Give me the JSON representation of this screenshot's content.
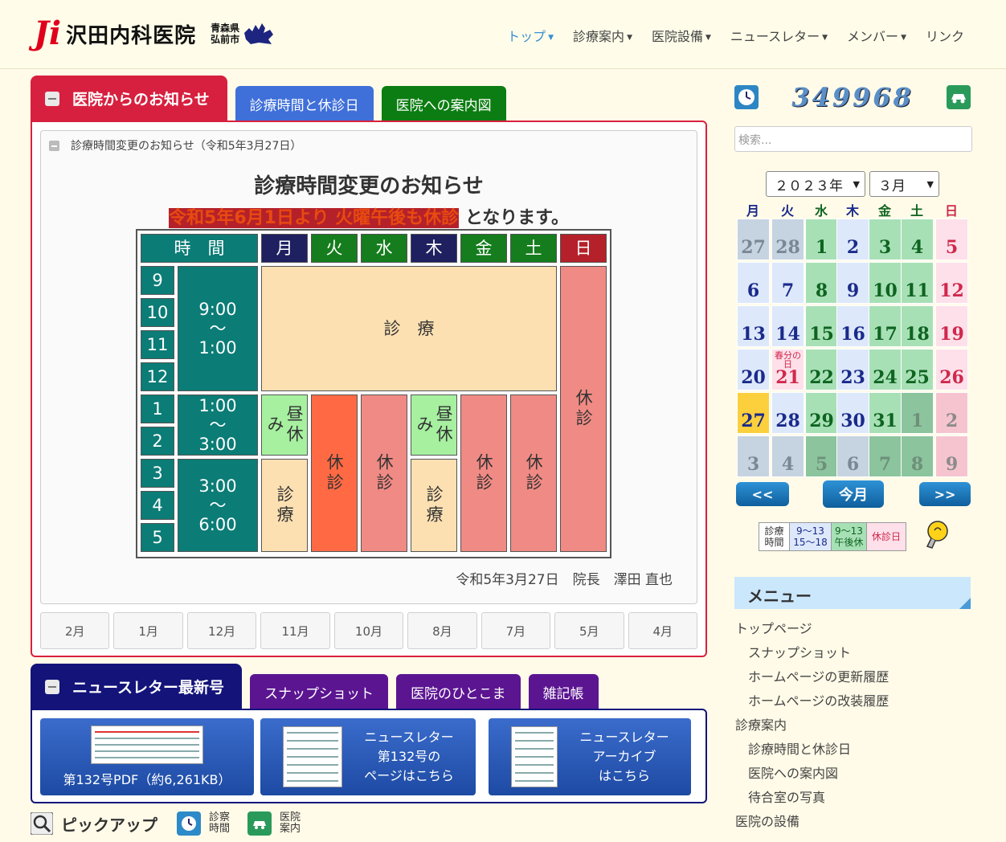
{
  "header": {
    "logo_mark": "Ji",
    "logo_name": "沢田内科医院",
    "logo_loc1": "青森県",
    "logo_loc2": "弘前市",
    "nav": [
      {
        "label": "トップ",
        "dropdown": true,
        "active": true
      },
      {
        "label": "診療案内",
        "dropdown": true
      },
      {
        "label": "医院設備",
        "dropdown": true
      },
      {
        "label": "ニュースレター",
        "dropdown": true
      },
      {
        "label": "メンバー",
        "dropdown": true
      },
      {
        "label": "リンク",
        "dropdown": false
      }
    ]
  },
  "tabs1": [
    {
      "label": "医院からのお知らせ",
      "color": "#d7203f"
    },
    {
      "label": "診療時間と休診日",
      "color": "#3f6fd8"
    },
    {
      "label": "医院への案内図",
      "color": "#0c7d12"
    }
  ],
  "notice": {
    "sub_title": "診療時間変更のお知らせ（令和5年3月27日）",
    "heading": "診療時間変更のお知らせ",
    "sub_red": "令和5年6月1日より 火曜午後も休診",
    "sub_tail": " となります。",
    "signature": "令和5年3月27日　院長　澤田 直也"
  },
  "schedule": {
    "col_time": "時　間",
    "days": [
      "月",
      "火",
      "水",
      "木",
      "金",
      "土",
      "日"
    ],
    "hours": [
      "9",
      "10",
      "11",
      "12",
      "1",
      "2",
      "3",
      "4",
      "5"
    ],
    "slot1": "9:00\n〜\n1:00",
    "slot2": "1:00\n〜\n3:00",
    "slot3": "3:00\n〜\n6:00",
    "morning": "診　療",
    "lunch": "昼休み",
    "closed": "休診",
    "open": "診療"
  },
  "months": [
    "2月",
    "1月",
    "12月",
    "11月",
    "10月",
    "8月",
    "7月",
    "5月",
    "4月"
  ],
  "tabs2": [
    {
      "label": "ニュースレター最新号",
      "color": "#13137a"
    },
    {
      "label": "スナップショット",
      "color": "#5b1591"
    },
    {
      "label": "医院のひとこま",
      "color": "#5b1591"
    },
    {
      "label": "雑記帳",
      "color": "#5b1591"
    }
  ],
  "newsletter": {
    "pdf_label": "第132号PDF（約6,261KB）",
    "page_line1": "ニュースレター",
    "page_line2": "第132号の",
    "page_line3": "ページはこちら",
    "arch_line1": "ニュースレター",
    "arch_line2": "アーカイブ",
    "arch_line3": "はこちら"
  },
  "pickup": {
    "title": "ピックアップ",
    "items": [
      {
        "l1": "診察",
        "l2": "時間",
        "icon": "clock-icon"
      },
      {
        "l1": "医院",
        "l2": "案内",
        "icon": "car-icon"
      }
    ]
  },
  "sidebar": {
    "counter": "349968",
    "search_placeholder": "検索...",
    "year": "２０２３年",
    "month": "３月",
    "dow": [
      "月",
      "火",
      "水",
      "木",
      "金",
      "土",
      "日"
    ],
    "prev": "<<",
    "today": "今月",
    "next": ">>",
    "legend_title": "診療\n時間",
    "legend_a": "9〜13\n15〜18",
    "legend_b": "9〜13\n午後休",
    "legend_c": "休診日",
    "menu_title": "メニュー",
    "menu": [
      {
        "label": "トップページ",
        "indent": false
      },
      {
        "label": "スナップショット",
        "indent": true
      },
      {
        "label": "ホームページの更新履歴",
        "indent": true
      },
      {
        "label": "ホームページの改装履歴",
        "indent": true
      },
      {
        "label": "診療案内",
        "indent": false
      },
      {
        "label": "診療時間と休診日",
        "indent": true
      },
      {
        "label": "医院への案内図",
        "indent": true
      },
      {
        "label": "待合室の写真",
        "indent": true
      },
      {
        "label": "医院の設備",
        "indent": false
      }
    ]
  },
  "calendar": {
    "weeks": [
      [
        {
          "d": "27",
          "t": "gray"
        },
        {
          "d": "28",
          "t": "gray"
        },
        {
          "d": "1",
          "t": "green"
        },
        {
          "d": "2",
          "t": "blue"
        },
        {
          "d": "3",
          "t": "green"
        },
        {
          "d": "4",
          "t": "green"
        },
        {
          "d": "5",
          "t": "sun"
        }
      ],
      [
        {
          "d": "6",
          "t": "blue"
        },
        {
          "d": "7",
          "t": "blue"
        },
        {
          "d": "8",
          "t": "green"
        },
        {
          "d": "9",
          "t": "blue"
        },
        {
          "d": "10",
          "t": "green"
        },
        {
          "d": "11",
          "t": "green"
        },
        {
          "d": "12",
          "t": "sun"
        }
      ],
      [
        {
          "d": "13",
          "t": "blue"
        },
        {
          "d": "14",
          "t": "blue"
        },
        {
          "d": "15",
          "t": "green"
        },
        {
          "d": "16",
          "t": "blue"
        },
        {
          "d": "17",
          "t": "green"
        },
        {
          "d": "18",
          "t": "green"
        },
        {
          "d": "19",
          "t": "sun"
        }
      ],
      [
        {
          "d": "20",
          "t": "blue"
        },
        {
          "d": "21",
          "t": "sun",
          "hol": "春分の日"
        },
        {
          "d": "22",
          "t": "green"
        },
        {
          "d": "23",
          "t": "blue"
        },
        {
          "d": "24",
          "t": "green"
        },
        {
          "d": "25",
          "t": "green"
        },
        {
          "d": "26",
          "t": "sun"
        }
      ],
      [
        {
          "d": "27",
          "t": "today"
        },
        {
          "d": "28",
          "t": "blue"
        },
        {
          "d": "29",
          "t": "green"
        },
        {
          "d": "30",
          "t": "blue"
        },
        {
          "d": "31",
          "t": "green"
        },
        {
          "d": "1",
          "t": "ggreen"
        },
        {
          "d": "2",
          "t": "gpink"
        }
      ],
      [
        {
          "d": "3",
          "t": "gray"
        },
        {
          "d": "4",
          "t": "gray"
        },
        {
          "d": "5",
          "t": "ggreen"
        },
        {
          "d": "6",
          "t": "gray"
        },
        {
          "d": "7",
          "t": "ggreen"
        },
        {
          "d": "8",
          "t": "ggreen"
        },
        {
          "d": "9",
          "t": "gpink"
        }
      ]
    ]
  }
}
